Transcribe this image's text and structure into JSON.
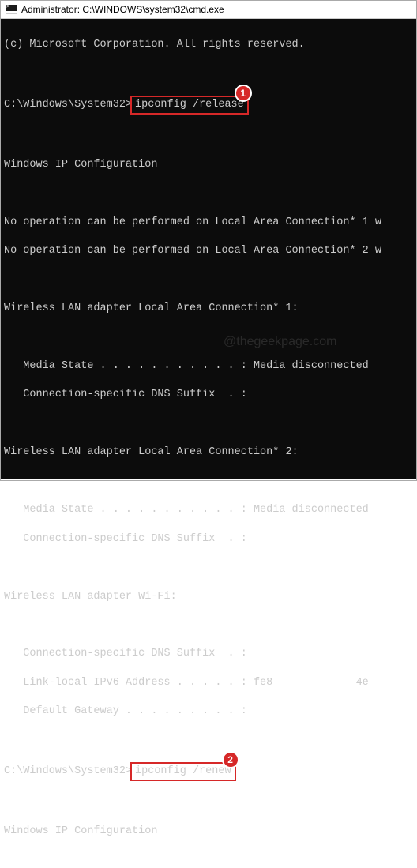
{
  "titlebar": {
    "title": "Administrator: C:\\WINDOWS\\system32\\cmd.exe"
  },
  "terminal": {
    "copyright": "(c) Microsoft Corporation. All rights reserved.",
    "prompt1_path": "C:\\Windows\\System32>",
    "cmd1": "ipconfig /release",
    "badge1": "1",
    "heading_ipconfig": "Windows IP Configuration",
    "noop1": "No operation can be performed on Local Area Connection* 1 w",
    "noop2": "No operation can be performed on Local Area Connection* 2 w",
    "adapter1_head": "Wireless LAN adapter Local Area Connection* 1:",
    "adapter1_media": "   Media State . . . . . . . . . . . : Media disconnected",
    "adapter1_dns": "   Connection-specific DNS Suffix  . :",
    "adapter2_head": "Wireless LAN adapter Local Area Connection* 2:",
    "adapter2_media": "   Media State . . . . . . . . . . . : Media disconnected",
    "adapter2_dns": "   Connection-specific DNS Suffix  . :",
    "wifi_head": "Wireless LAN adapter Wi-Fi:",
    "wifi_dns": "   Connection-specific DNS Suffix  . :",
    "wifi_ipv6": "   Link-local IPv6 Address . . . . . : fe8             4e",
    "wifi_gw": "   Default Gateway . . . . . . . . . :",
    "prompt2_path": "C:\\Windows\\System32>",
    "cmd2": "ipconfig /renew",
    "badge2": "2",
    "heading_ipconfig2": "Windows IP Configuration"
  },
  "watermark": "@thegeekpage.com"
}
